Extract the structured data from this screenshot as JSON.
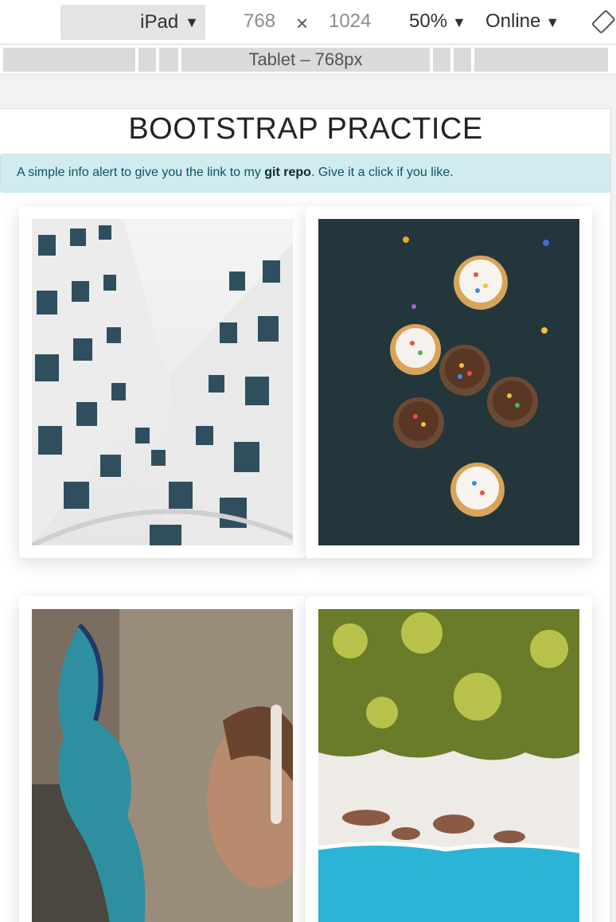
{
  "toolbar": {
    "device": "iPad",
    "width": "768",
    "height": "1024",
    "times": "×",
    "zoom": "50%",
    "network": "Online"
  },
  "ruler": {
    "label": "Tablet – 768px"
  },
  "page": {
    "title": "BOOTSTRAP PRACTICE",
    "alert": {
      "before": "A simple info alert to give you the link to my ",
      "link": "git repo",
      "after": ". Give it a click if you like."
    }
  },
  "cards": [
    {
      "image": "building-photo"
    },
    {
      "image": "cupcakes-photo"
    },
    {
      "image": "graffiti-photo"
    },
    {
      "image": "beach-photo"
    }
  ],
  "colors": {
    "alert_bg": "#d1ecf1",
    "alert_text": "#0c5460"
  }
}
